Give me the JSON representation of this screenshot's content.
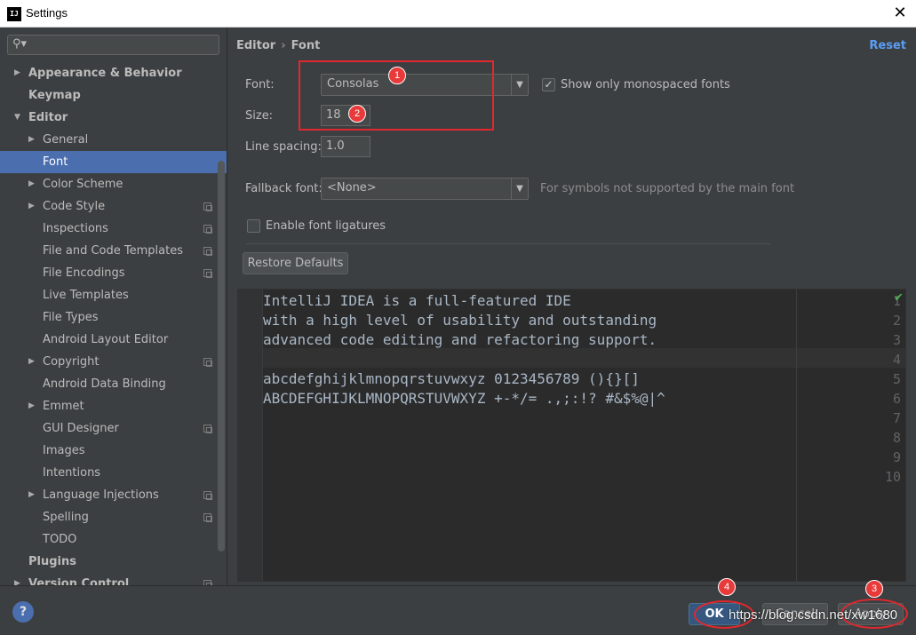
{
  "window": {
    "title": "Settings",
    "app_icon_text": "IJ",
    "close_glyph": "✕"
  },
  "sidebar": {
    "search_placeholder": "",
    "search_icon_glyph": "⚲▾",
    "items": [
      {
        "label": "Appearance & Behavior",
        "level": 0,
        "arrow": "▶",
        "bold": true
      },
      {
        "label": "Keymap",
        "level": 0,
        "arrow": "",
        "bold": true
      },
      {
        "label": "Editor",
        "level": 0,
        "arrow": "▼",
        "bold": true
      },
      {
        "label": "General",
        "level": 1,
        "arrow": "▶"
      },
      {
        "label": "Font",
        "level": 1,
        "arrow": "",
        "selected": true
      },
      {
        "label": "Color Scheme",
        "level": 1,
        "arrow": "▶"
      },
      {
        "label": "Code Style",
        "level": 1,
        "arrow": "▶",
        "copy": true
      },
      {
        "label": "Inspections",
        "level": 1,
        "arrow": "",
        "copy": true
      },
      {
        "label": "File and Code Templates",
        "level": 1,
        "arrow": "",
        "copy": true
      },
      {
        "label": "File Encodings",
        "level": 1,
        "arrow": "",
        "copy": true
      },
      {
        "label": "Live Templates",
        "level": 1,
        "arrow": ""
      },
      {
        "label": "File Types",
        "level": 1,
        "arrow": ""
      },
      {
        "label": "Android Layout Editor",
        "level": 1,
        "arrow": ""
      },
      {
        "label": "Copyright",
        "level": 1,
        "arrow": "▶",
        "copy": true
      },
      {
        "label": "Android Data Binding",
        "level": 1,
        "arrow": ""
      },
      {
        "label": "Emmet",
        "level": 1,
        "arrow": "▶"
      },
      {
        "label": "GUI Designer",
        "level": 1,
        "arrow": "",
        "copy": true
      },
      {
        "label": "Images",
        "level": 1,
        "arrow": ""
      },
      {
        "label": "Intentions",
        "level": 1,
        "arrow": ""
      },
      {
        "label": "Language Injections",
        "level": 1,
        "arrow": "▶",
        "copy": true
      },
      {
        "label": "Spelling",
        "level": 1,
        "arrow": "",
        "copy": true
      },
      {
        "label": "TODO",
        "level": 1,
        "arrow": ""
      },
      {
        "label": "Plugins",
        "level": 0,
        "arrow": "",
        "bold": true
      },
      {
        "label": "Version Control",
        "level": 0,
        "arrow": "▶",
        "bold": true,
        "copy": true
      }
    ]
  },
  "main": {
    "breadcrumb": {
      "parent": "Editor",
      "separator": "›",
      "current": "Font"
    },
    "reset_label": "Reset",
    "font": {
      "label": "Font:",
      "value": "Consolas",
      "dropdown_glyph": "▼"
    },
    "show_monospaced": {
      "checked": true,
      "label": "Show only monospaced fonts",
      "check_glyph": "✓"
    },
    "size": {
      "label": "Size:",
      "value": "18"
    },
    "line_spacing": {
      "label": "Line spacing:",
      "value": "1.0"
    },
    "fallback": {
      "label": "Fallback font:",
      "value": "<None>",
      "hint": "For symbols not supported by the main font"
    },
    "ligatures": {
      "checked": false,
      "label": "Enable font ligatures"
    },
    "restore_defaults_label": "Restore Defaults",
    "preview": {
      "lines": [
        {
          "no": "1",
          "text": "IntelliJ IDEA is a full-featured IDE"
        },
        {
          "no": "2",
          "text": "with a high level of usability and outstanding"
        },
        {
          "no": "3",
          "text": "advanced code editing and refactoring support."
        },
        {
          "no": "4",
          "text": ""
        },
        {
          "no": "5",
          "text": "abcdefghijklmnopqrstuvwxyz 0123456789 (){}[]"
        },
        {
          "no": "6",
          "text": "ABCDEFGHIJKLMNOPQRSTUVWXYZ +-*/= .,;:!? #&$%@|^"
        },
        {
          "no": "7",
          "text": ""
        },
        {
          "no": "8",
          "text": ""
        },
        {
          "no": "9",
          "text": ""
        },
        {
          "no": "10",
          "text": ""
        }
      ],
      "status_glyph": "✔"
    }
  },
  "annotations": {
    "badges": [
      "1",
      "2",
      "3",
      "4"
    ],
    "color": "#e0282e"
  },
  "footer": {
    "help_label": "?",
    "ok_label": "OK",
    "cancel_label": "Cancel",
    "apply_label": "Apply",
    "watermark": "https://blog.csdn.net/xw1680"
  },
  "colors": {
    "background": "#3c3f41",
    "selection": "#4b6eaf",
    "accent_link": "#589df6",
    "editor_bg": "#2b2b2b"
  }
}
